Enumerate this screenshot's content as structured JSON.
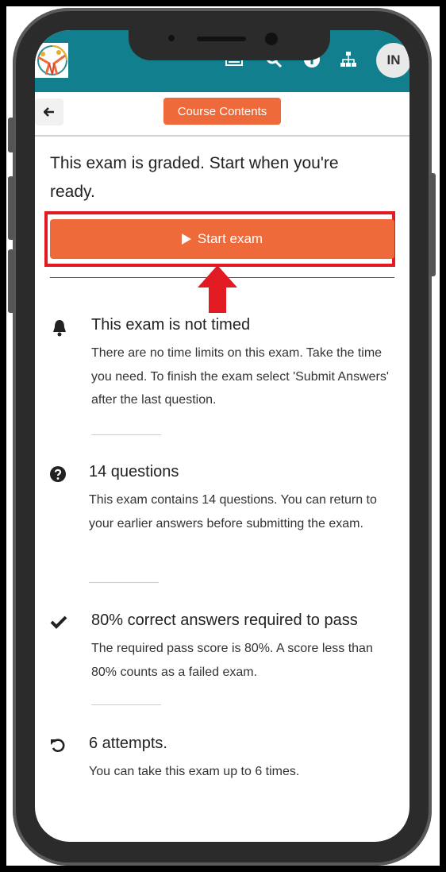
{
  "header": {
    "logo_name": "organization-logo",
    "icons": [
      "book-icon",
      "search-icon",
      "info-icon",
      "sitemap-icon"
    ],
    "avatar_initials": "IN"
  },
  "subbar": {
    "back_label": "←",
    "course_contents_label": "Course Contents"
  },
  "exam": {
    "intro": "This exam is graded. Start when you're ready.",
    "start_label": "Start exam",
    "items": [
      {
        "icon": "bell-icon",
        "title": "This exam is not timed",
        "description": "There are no time limits on this exam. Take the time you need.  To finish the exam select 'Submit Answers' after the last question."
      },
      {
        "icon": "question-circle-icon",
        "title": "14 questions",
        "description": "This exam contains 14 questions. You can return to your earlier answers before submitting the exam."
      },
      {
        "icon": "check-icon",
        "title": "80% correct answers required to pass",
        "description": "The required pass score is 80%. A score less than 80% counts as a failed exam."
      },
      {
        "icon": "undo-icon",
        "title": "6 attempts.",
        "description": "You can take this exam up to 6 times."
      }
    ]
  },
  "annotation": {
    "highlight_color": "#e21b23",
    "target": "Start exam"
  },
  "colors": {
    "header": "#127f8e",
    "accent": "#ef6a3a"
  }
}
